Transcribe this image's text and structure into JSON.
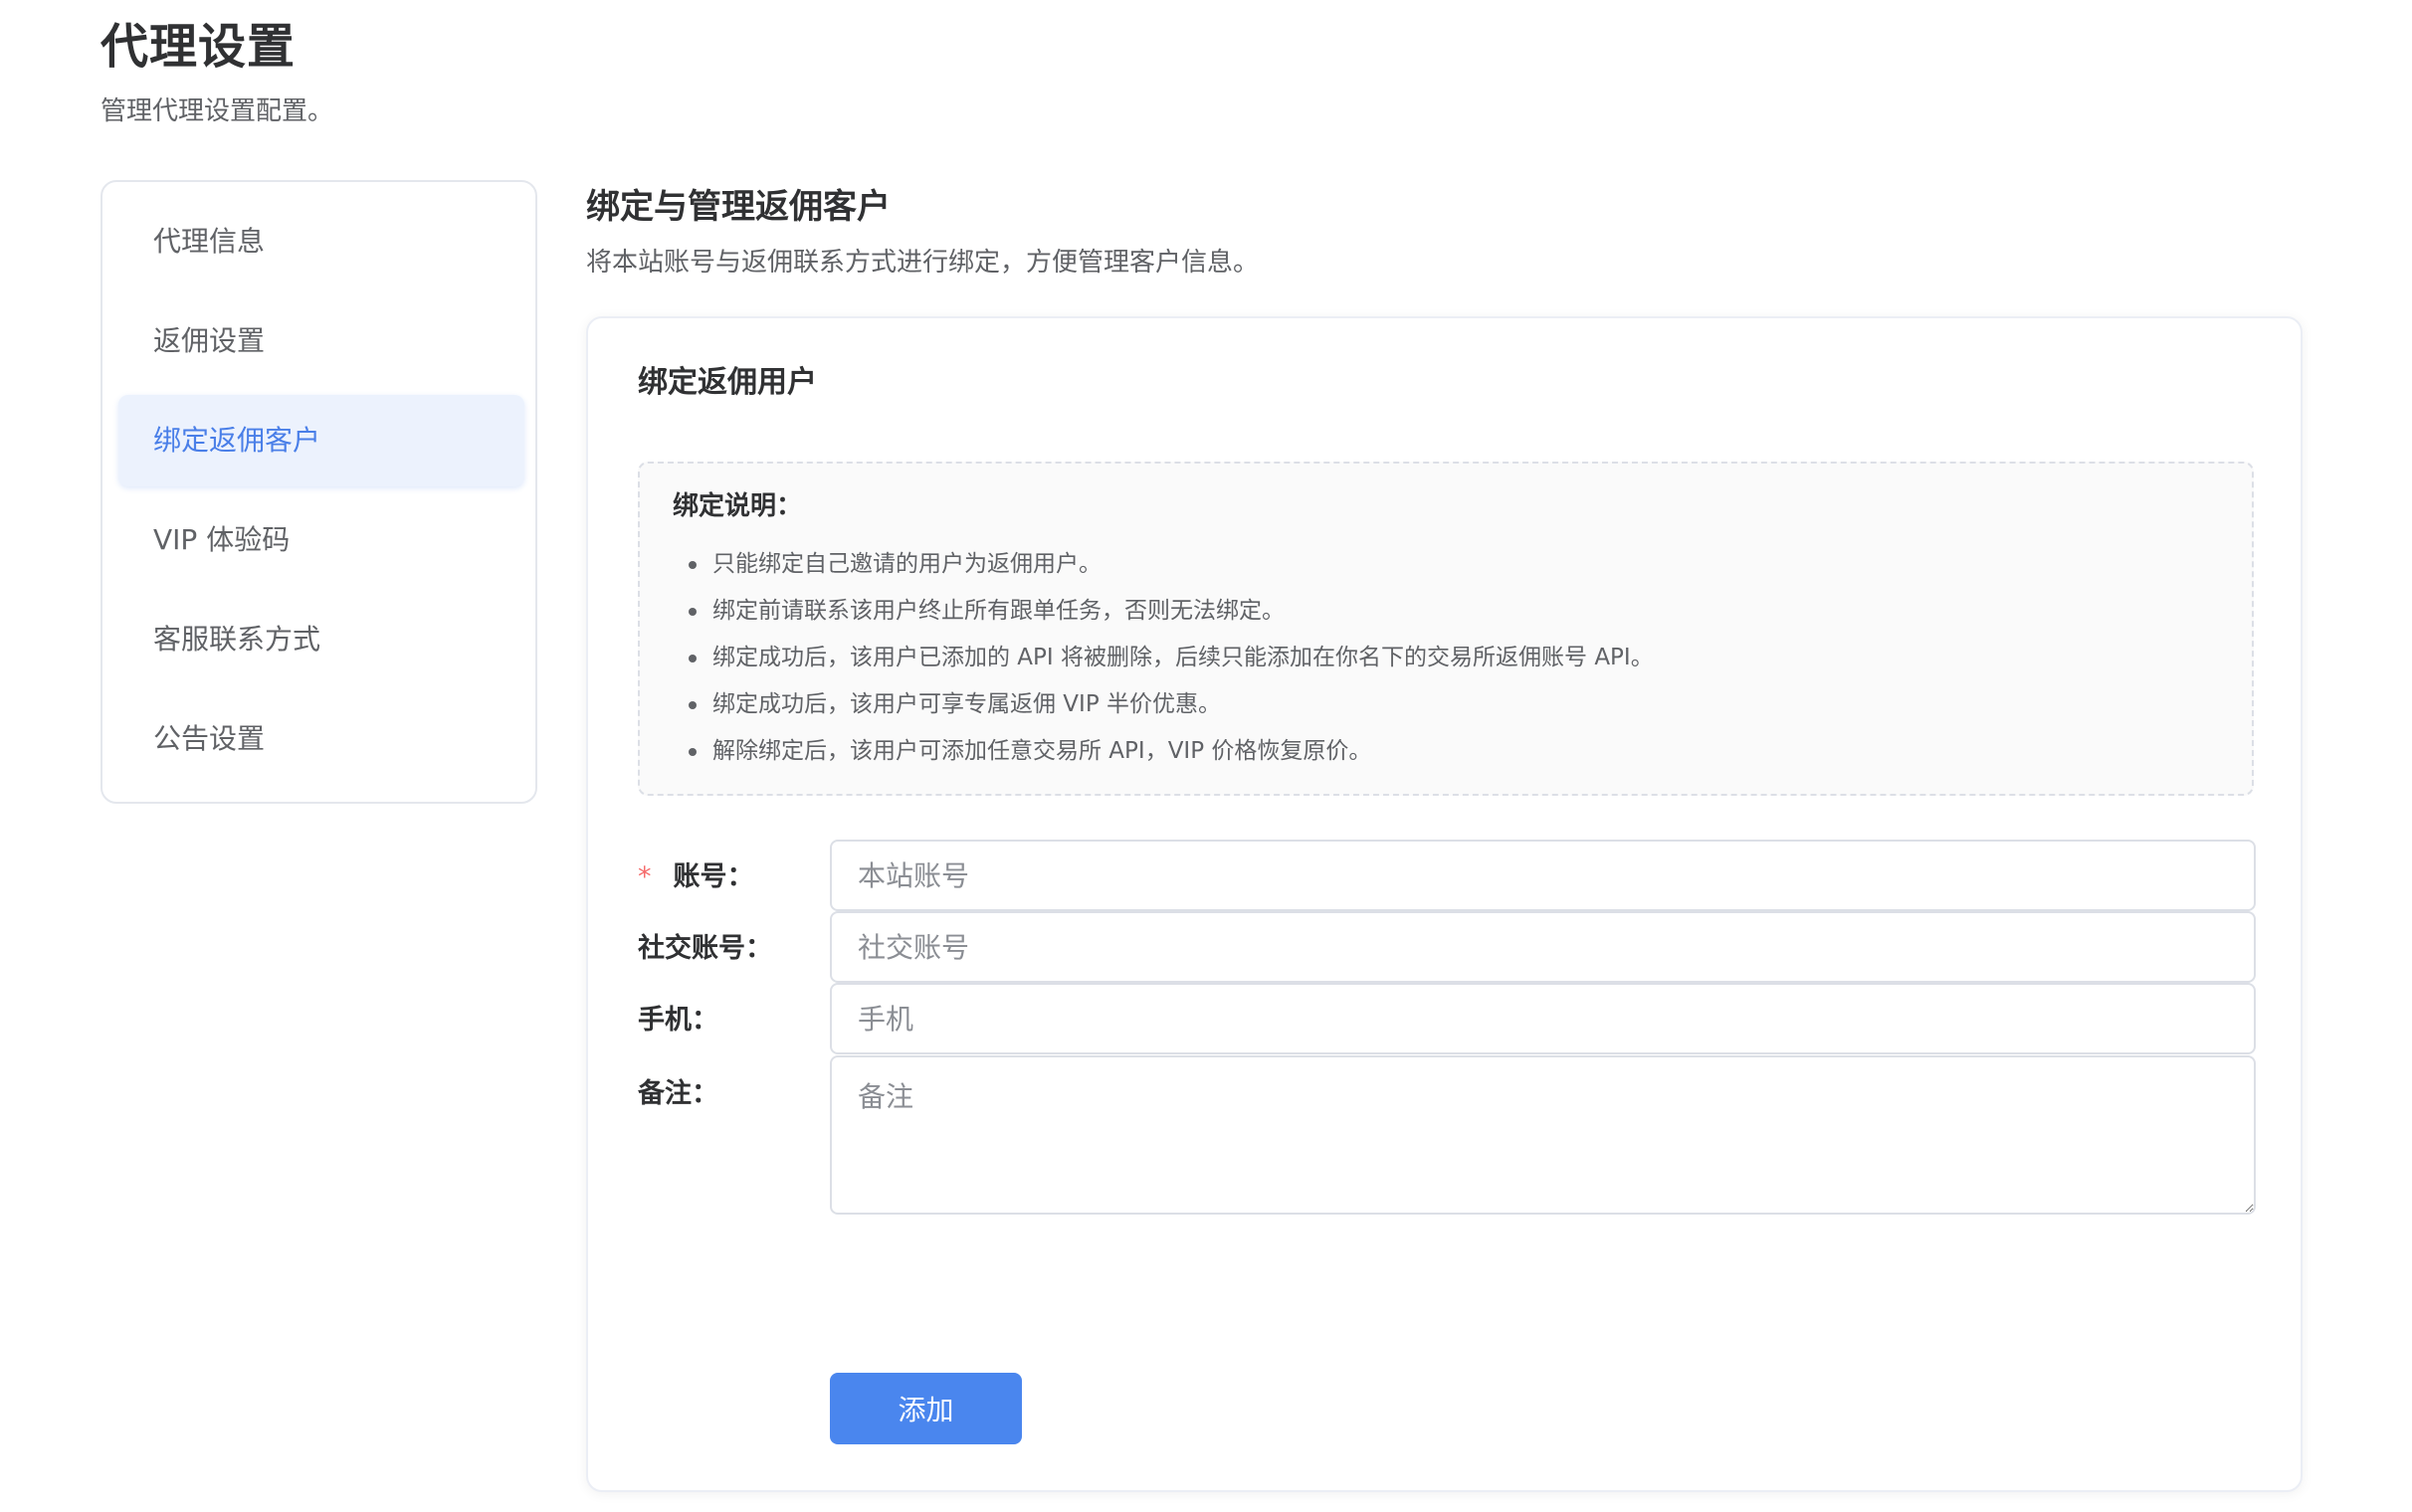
{
  "page": {
    "title": "代理设置",
    "subtitle": "管理代理设置配置。"
  },
  "sidebar": {
    "items": [
      {
        "label": "代理信息",
        "active": false
      },
      {
        "label": "返佣设置",
        "active": false
      },
      {
        "label": "绑定返佣客户",
        "active": true
      },
      {
        "label": "VIP 体验码",
        "active": false
      },
      {
        "label": "客服联系方式",
        "active": false
      },
      {
        "label": "公告设置",
        "active": false
      }
    ]
  },
  "section": {
    "title": "绑定与管理返佣客户",
    "description": "将本站账号与返佣联系方式进行绑定，方便管理客户信息。"
  },
  "card": {
    "title": "绑定返佣用户",
    "notes": {
      "title": "绑定说明：",
      "items": [
        "只能绑定自己邀请的用户为返佣用户。",
        "绑定前请联系该用户终止所有跟单任务，否则无法绑定。",
        "绑定成功后，该用户已添加的 API 将被删除，后续只能添加在你名下的交易所返佣账号 API。",
        "绑定成功后，该用户可享专属返佣 VIP 半价优惠。",
        "解除绑定后，该用户可添加任意交易所 API，VIP 价格恢复原价。"
      ]
    },
    "form": {
      "required_mark": "*",
      "account": {
        "label": "账号：",
        "value": "",
        "placeholder": "本站账号"
      },
      "social": {
        "label": "社交账号：",
        "value": "",
        "placeholder": "社交账号"
      },
      "phone": {
        "label": "手机：",
        "value": "",
        "placeholder": "手机"
      },
      "remark": {
        "label": "备注：",
        "value": "",
        "placeholder": "备注"
      },
      "submit_label": "添加"
    }
  },
  "colors": {
    "accent": "#4a86ee",
    "active_bg": "#ecf2fd",
    "required": "#f56c6c"
  }
}
